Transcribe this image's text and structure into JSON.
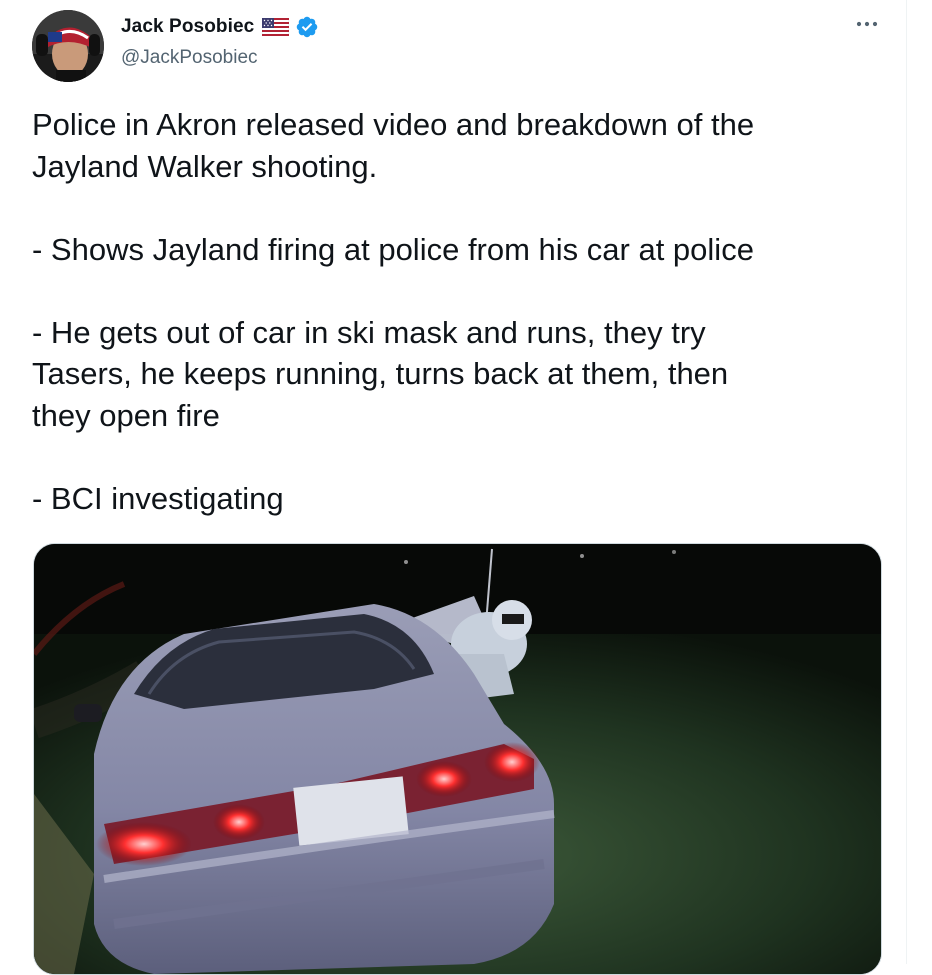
{
  "author": {
    "display_name": "Jack Posobiec",
    "handle": "@JackPosobiec",
    "flag_icon": "us-flag-icon",
    "verified_icon": "verified-badge-icon",
    "verified_color": "#1d9bf0"
  },
  "more_icon": "more-options-icon",
  "tweet": {
    "lines": [
      "Police in Akron released video and breakdown of the",
      "Jayland Walker shooting.",
      "",
      "- Shows Jayland firing at police from his car at police",
      "",
      "- He gets out of car in ski mask and runs, they try",
      "Tasers, he keeps running, turns back at them, then",
      "they open fire",
      "",
      "- BCI investigating"
    ]
  },
  "colors": {
    "text": "#0f1419",
    "secondary": "#536471",
    "border": "#cfd9de"
  }
}
